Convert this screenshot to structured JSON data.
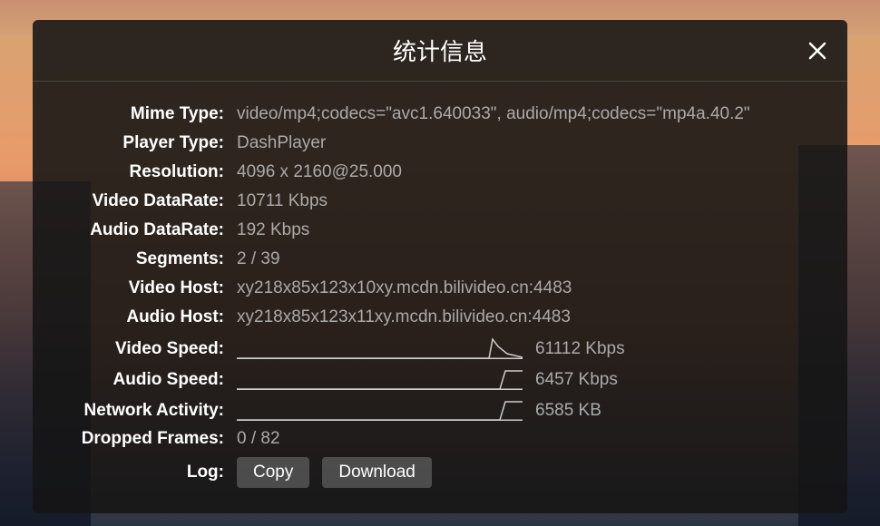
{
  "modal": {
    "title": "统计信息"
  },
  "stats": {
    "mime_type": {
      "label": "Mime Type:",
      "value": "video/mp4;codecs=\"avc1.640033\", audio/mp4;codecs=\"mp4a.40.2\""
    },
    "player_type": {
      "label": "Player Type:",
      "value": "DashPlayer"
    },
    "resolution": {
      "label": "Resolution:",
      "value": "4096 x 2160@25.000"
    },
    "video_datarate": {
      "label": "Video DataRate:",
      "value": "10711 Kbps"
    },
    "audio_datarate": {
      "label": "Audio DataRate:",
      "value": "192 Kbps"
    },
    "segments": {
      "label": "Segments:",
      "value": "2 / 39"
    },
    "video_host": {
      "label": "Video Host:",
      "value": "xy218x85x123x10xy.mcdn.bilivideo.cn:4483"
    },
    "audio_host": {
      "label": "Audio Host:",
      "value": "xy218x85x123x11xy.mcdn.bilivideo.cn:4483"
    },
    "video_speed": {
      "label": "Video Speed:",
      "value": "61112 Kbps"
    },
    "audio_speed": {
      "label": "Audio Speed:",
      "value": "6457 Kbps"
    },
    "network_activity": {
      "label": "Network Activity:",
      "value": "6585 KB"
    },
    "dropped_frames": {
      "label": "Dropped Frames:",
      "value": "0 / 82"
    },
    "log": {
      "label": "Log:"
    }
  },
  "buttons": {
    "copy": "Copy",
    "download": "Download"
  },
  "chart_data": [
    {
      "type": "line",
      "name": "video_speed",
      "title": "Video Speed",
      "ylabel": "Kbps",
      "ylim": [
        0,
        70000
      ],
      "x": [
        0,
        1,
        2,
        3,
        4,
        5,
        6,
        7,
        8,
        9,
        10,
        11,
        12,
        13,
        14,
        15,
        16,
        17,
        18,
        19
      ],
      "values": [
        0,
        0,
        0,
        0,
        0,
        0,
        0,
        0,
        0,
        0,
        0,
        0,
        0,
        0,
        0,
        0,
        0,
        61112,
        35000,
        10000
      ]
    },
    {
      "type": "line",
      "name": "audio_speed",
      "title": "Audio Speed",
      "ylabel": "Kbps",
      "ylim": [
        0,
        7000
      ],
      "x": [
        0,
        1,
        2,
        3,
        4,
        5,
        6,
        7,
        8,
        9,
        10,
        11,
        12,
        13,
        14,
        15,
        16,
        17,
        18,
        19
      ],
      "values": [
        0,
        0,
        0,
        0,
        0,
        0,
        0,
        0,
        0,
        0,
        0,
        0,
        0,
        0,
        0,
        0,
        0,
        0,
        6457,
        6457
      ]
    },
    {
      "type": "line",
      "name": "network_activity",
      "title": "Network Activity",
      "ylabel": "KB",
      "ylim": [
        0,
        7000
      ],
      "x": [
        0,
        1,
        2,
        3,
        4,
        5,
        6,
        7,
        8,
        9,
        10,
        11,
        12,
        13,
        14,
        15,
        16,
        17,
        18,
        19
      ],
      "values": [
        0,
        0,
        0,
        0,
        0,
        0,
        0,
        0,
        0,
        0,
        0,
        0,
        0,
        0,
        0,
        0,
        0,
        0,
        6585,
        6585
      ]
    }
  ]
}
